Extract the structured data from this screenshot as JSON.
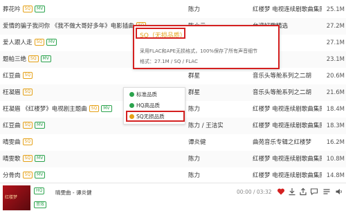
{
  "songs": [
    {
      "title": "葬花吟",
      "badges": [
        "SQ",
        "MV"
      ],
      "singer": "",
      "album": "红楼梦 电视连续剧歌曲集原声带",
      "size": "25.1M"
    },
    {
      "title": "爱情的骗子我问你 《我不做大哥好多年》电影插曲",
      "badges": [
        "SQ"
      ],
      "singer": "陈小云",
      "album": "台湾好歌精选",
      "size": "27.2M"
    },
    {
      "title": "爱人跟人走",
      "badges": [
        "SQ",
        "MV"
      ],
      "singer": "",
      "album": "",
      "size": "27.1M"
    },
    {
      "title": "题帕三绝",
      "badges": [
        "SQ",
        "MV"
      ],
      "singer": "",
      "album": "",
      "size": "23.1M"
    },
    {
      "title": "红豆曲",
      "badges": [
        "SQ"
      ],
      "singer": "群星",
      "album": "音乐头等舱系列之二胡",
      "size": "20.6M"
    },
    {
      "title": "枉凝眉",
      "badges": [
        "SQ"
      ],
      "singer": "群星",
      "album": "音乐头等舱系列之二胡",
      "size": "21.6M"
    },
    {
      "title": "枉凝眉 《红楼梦》电视剧主题曲",
      "badges": [
        "SQ",
        "MV"
      ],
      "singer": "陈力",
      "album": "红楼梦 电视连续剧歌曲集原声带",
      "size": "18.4M"
    },
    {
      "title": "红豆曲",
      "badges": [
        "SQ",
        "MV"
      ],
      "singer": "陈力 / 王洁实",
      "album": "红楼梦 电视连续剧歌曲集原声带",
      "size": "18.3M"
    },
    {
      "title": "晴雯曲",
      "badges": [
        "SQ"
      ],
      "singer": "谭炎健",
      "album": "曲苑音乐专辑之红楼梦",
      "size": "16.2M"
    },
    {
      "title": "晴雯歌",
      "badges": [
        "SQ",
        "MV"
      ],
      "singer": "陈力",
      "album": "红楼梦 电视连续剧歌曲集原声带",
      "size": "10.8M"
    },
    {
      "title": "分骨肉",
      "badges": [
        "SQ",
        "MV"
      ],
      "singer": "陈力",
      "album": "红楼梦 电视连续剧歌曲集原声带",
      "size": "14.8M"
    },
    {
      "title": "红楼梦曲",
      "badges": [
        "SQ"
      ],
      "singer": "王立平",
      "album": "红楼梦 电视连续剧歌曲集原声带",
      "size": "3.9M"
    }
  ],
  "first_row_singer": "陈力",
  "tooltip": {
    "title": "SQ（无损品质）",
    "line1": "采用FLAC和APE无损格式，100%保存了所有声音细节",
    "line2": "格式：27.1M / SQ / FLAC"
  },
  "quality_menu": [
    {
      "label": "标准品质",
      "color": "#2ba34d"
    },
    {
      "label": "HQ高品质",
      "color": "#2ba34d"
    },
    {
      "label": "SQ无损品质",
      "color": "#e5a117"
    }
  ],
  "player": {
    "badge1": "HQ",
    "badge2": "音效",
    "song": "晴雯曲 - 谭炎健",
    "time": "00:00 / 03:32"
  },
  "colors": {
    "sq": "#e5a117",
    "mv": "#2ba34d",
    "highlight": "#d42020"
  }
}
